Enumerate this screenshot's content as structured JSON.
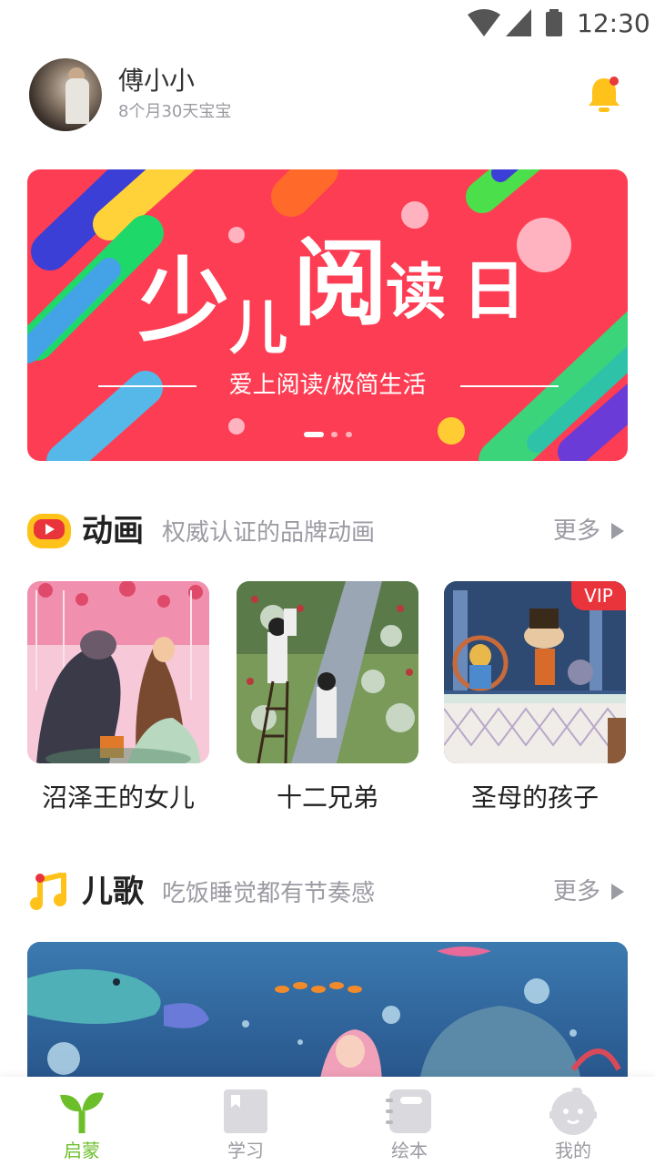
{
  "status_bar": {
    "time": "12:30",
    "icons": [
      "wifi-icon",
      "signal-icon",
      "battery-icon"
    ]
  },
  "profile": {
    "name": "傅小小",
    "age": "8个月30天宝宝",
    "notification_icon": "bell-icon",
    "has_badge": true
  },
  "banner": {
    "title_chars": [
      "少",
      "儿",
      "阅",
      "读",
      "日"
    ],
    "subtitle": "爱上阅读/极简生活",
    "page_indicator": {
      "count": 3,
      "active": 1
    },
    "bg_color": "#fd3d53"
  },
  "animation_section": {
    "title": "动画",
    "desc": "权威认证的品牌动画",
    "more": "更多",
    "icon": "tv-icon",
    "items": [
      {
        "label": "沼泽王的女儿",
        "vip": ""
      },
      {
        "label": "十二兄弟",
        "vip": ""
      },
      {
        "label": "圣母的孩子",
        "vip": "VIP"
      }
    ]
  },
  "song_section": {
    "title": "儿歌",
    "desc": "吃饭睡觉都有节奏感",
    "more": "更多",
    "icon": "music-note-icon"
  },
  "tabbar": {
    "active_color": "#6cbf2b",
    "tabs": [
      {
        "label": "启蒙",
        "icon": "sprout-icon",
        "active": true
      },
      {
        "label": "学习",
        "icon": "book-icon",
        "active": false
      },
      {
        "label": "绘本",
        "icon": "notebook-icon",
        "active": false
      },
      {
        "label": "我的",
        "icon": "baby-face-icon",
        "active": false
      }
    ]
  }
}
